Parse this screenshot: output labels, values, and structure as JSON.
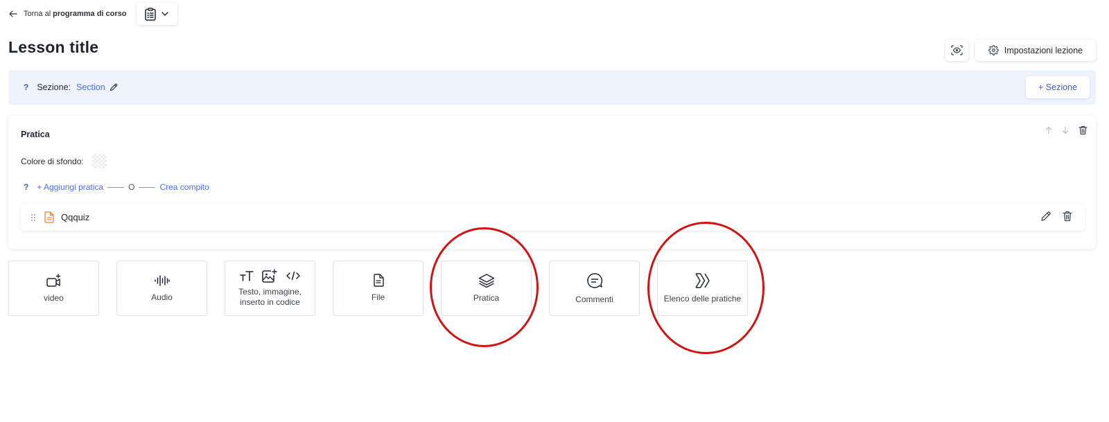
{
  "topbar": {
    "back_prefix": "Torna al",
    "back_bold": "programma di corso"
  },
  "page": {
    "title": "Lesson title"
  },
  "header_actions": {
    "settings_label": "Impostazioni lezione"
  },
  "section_bar": {
    "help_mark": "?",
    "label": "Sezione:",
    "value": "Section",
    "add_button": "+ Sezione"
  },
  "practice_block": {
    "title": "Pratica",
    "background_label": "Colore di sfondo:",
    "help_mark": "?",
    "add_practice": "+ Aggiungi pratica",
    "or_text": "O",
    "create_task": "Crea compito",
    "item_name": "Qqquiz"
  },
  "tiles": [
    {
      "label": "video",
      "icon": "video-plus-icon"
    },
    {
      "label": "Audio",
      "icon": "audio-wave-icon"
    },
    {
      "label": "Testo, immagine, inserto in codice",
      "icon": "text-image-code-icons"
    },
    {
      "label": "File",
      "icon": "file-icon"
    },
    {
      "label": "Pratica",
      "icon": "layers-icon"
    },
    {
      "label": "Commenti",
      "icon": "comment-icon"
    },
    {
      "label": "Elenco delle pratiche",
      "icon": "chevrons-icon"
    }
  ],
  "colors": {
    "accent": "#4a6cf0",
    "section_bg": "#eef3fd",
    "annotation_circle": "#d01414",
    "file_icon": "#e8823c"
  }
}
